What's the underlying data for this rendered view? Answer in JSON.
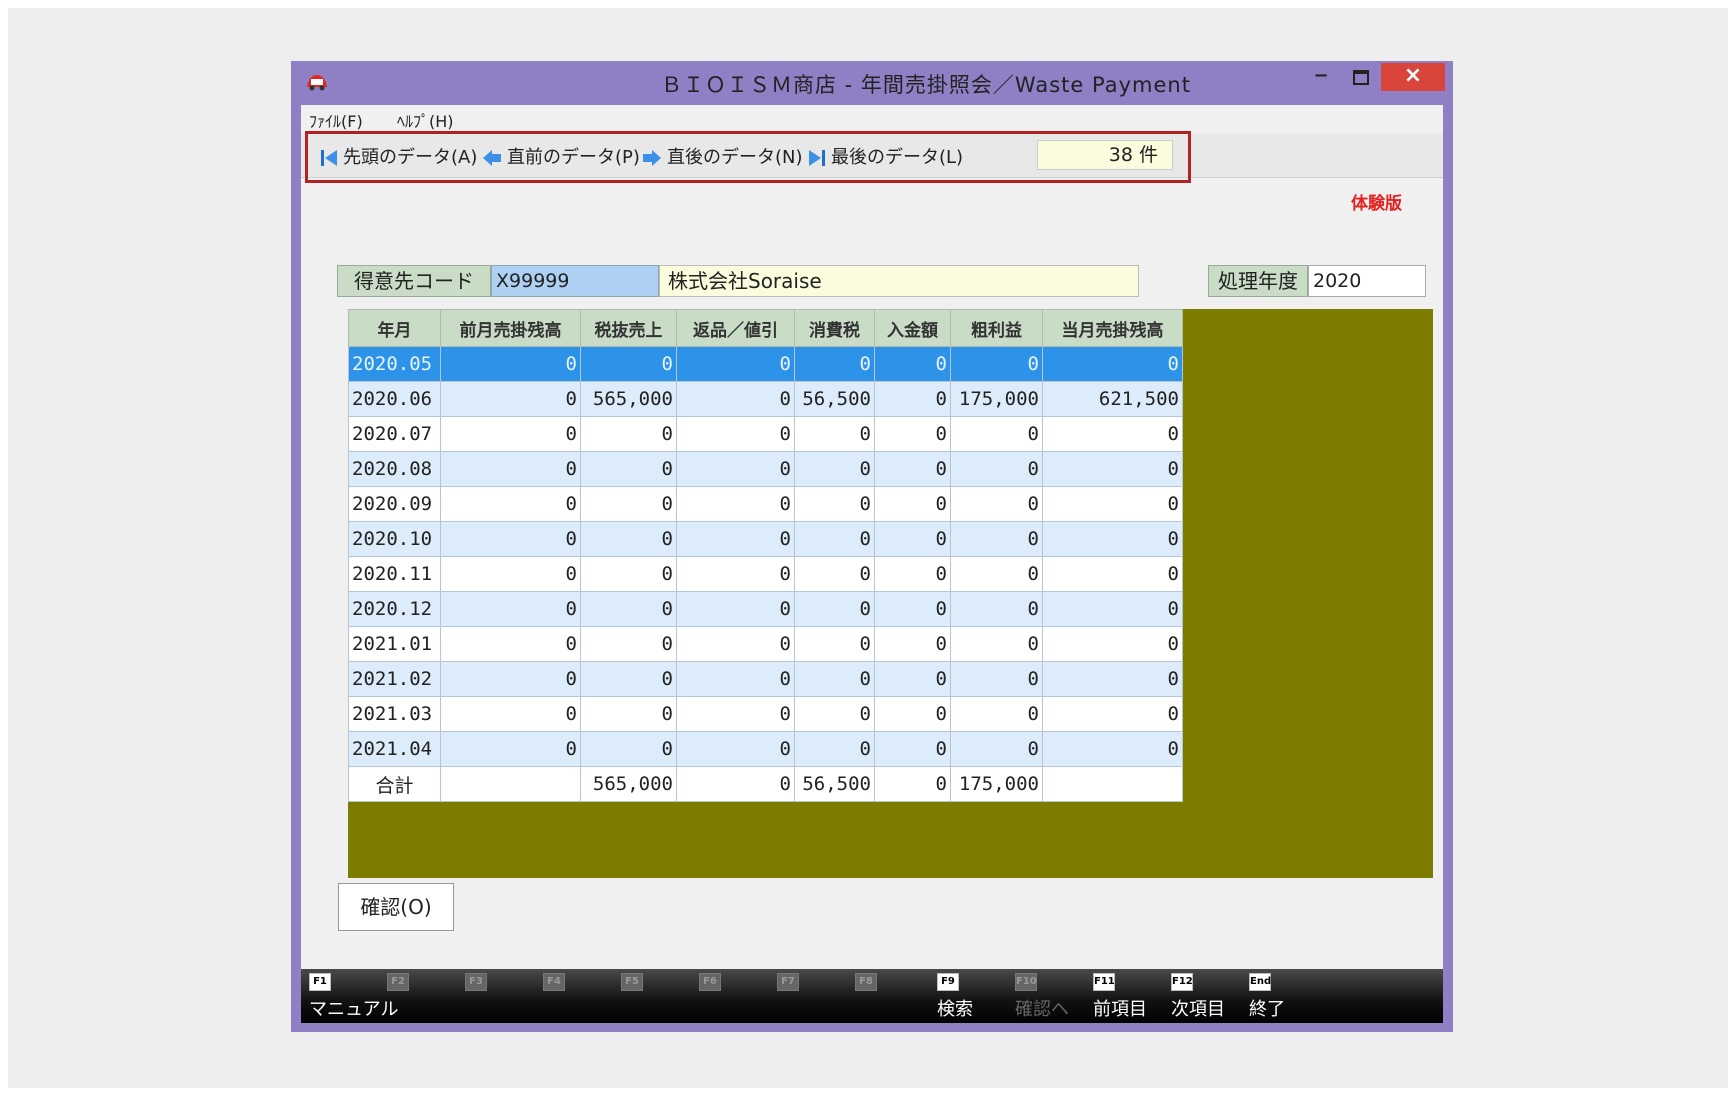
{
  "window": {
    "title": "ＢＩＯＩＳＭ商店 - 年間売掛照会／Waste Payment"
  },
  "menu": [
    {
      "label": "ﾌｧｲﾙ(F)"
    },
    {
      "label": "ﾍﾙﾌﾟ(H)"
    }
  ],
  "nav": {
    "first": "先頭のデータ(A)",
    "prev": "直前のデータ(P)",
    "next": "直後のデータ(N)",
    "last": "最後のデータ(L)",
    "count": "38 件"
  },
  "trial_badge": "体験版",
  "form": {
    "customer_code_label": "得意先コード",
    "customer_code": "X99999",
    "customer_name": "株式会社Soraise",
    "fiscal_year_label": "処理年度",
    "fiscal_year": "2020"
  },
  "grid": {
    "columns": [
      "年月",
      "前月売掛残高",
      "税抜売上",
      "返品／値引",
      "消費税",
      "入金額",
      "粗利益",
      "当月売掛残高"
    ],
    "rows": [
      [
        "2020.05",
        "0",
        "0",
        "0",
        "0",
        "0",
        "0",
        "0"
      ],
      [
        "2020.06",
        "0",
        "565,000",
        "0",
        "56,500",
        "0",
        "175,000",
        "621,500"
      ],
      [
        "2020.07",
        "0",
        "0",
        "0",
        "0",
        "0",
        "0",
        "0"
      ],
      [
        "2020.08",
        "0",
        "0",
        "0",
        "0",
        "0",
        "0",
        "0"
      ],
      [
        "2020.09",
        "0",
        "0",
        "0",
        "0",
        "0",
        "0",
        "0"
      ],
      [
        "2020.10",
        "0",
        "0",
        "0",
        "0",
        "0",
        "0",
        "0"
      ],
      [
        "2020.11",
        "0",
        "0",
        "0",
        "0",
        "0",
        "0",
        "0"
      ],
      [
        "2020.12",
        "0",
        "0",
        "0",
        "0",
        "0",
        "0",
        "0"
      ],
      [
        "2021.01",
        "0",
        "0",
        "0",
        "0",
        "0",
        "0",
        "0"
      ],
      [
        "2021.02",
        "0",
        "0",
        "0",
        "0",
        "0",
        "0",
        "0"
      ],
      [
        "2021.03",
        "0",
        "0",
        "0",
        "0",
        "0",
        "0",
        "0"
      ],
      [
        "2021.04",
        "0",
        "0",
        "0",
        "0",
        "0",
        "0",
        "0"
      ]
    ],
    "selected_row": 0,
    "total": [
      "合計",
      "",
      "565,000",
      "0",
      "56,500",
      "0",
      "175,000",
      ""
    ]
  },
  "confirm_button": "確認(O)",
  "fkeys": [
    {
      "key": "F1",
      "label": "マニュアル",
      "enabled": true
    },
    {
      "key": "F2",
      "label": "",
      "enabled": false
    },
    {
      "key": "F3",
      "label": "",
      "enabled": false
    },
    {
      "key": "F4",
      "label": "",
      "enabled": false
    },
    {
      "key": "F5",
      "label": "",
      "enabled": false
    },
    {
      "key": "F6",
      "label": "",
      "enabled": false
    },
    {
      "key": "F7",
      "label": "",
      "enabled": false
    },
    {
      "key": "F8",
      "label": "",
      "enabled": false
    },
    {
      "key": "F9",
      "label": "検索",
      "enabled": true
    },
    {
      "key": "F10",
      "label": "確認へ",
      "enabled": false
    },
    {
      "key": "F11",
      "label": "前項目",
      "enabled": true
    },
    {
      "key": "F12",
      "label": "次項目",
      "enabled": true
    },
    {
      "key": "End",
      "label": "終了",
      "enabled": true
    }
  ],
  "colors": {
    "window_frame": "#8f7fc4",
    "close_button": "#d9453a",
    "grid_background": "#7c7c00",
    "selected_row": "#2d93e8",
    "alt_row": "#dcecfa",
    "header": "#c8dcc6",
    "highlight_box": "#b22222",
    "trial_badge": "#e52020"
  }
}
